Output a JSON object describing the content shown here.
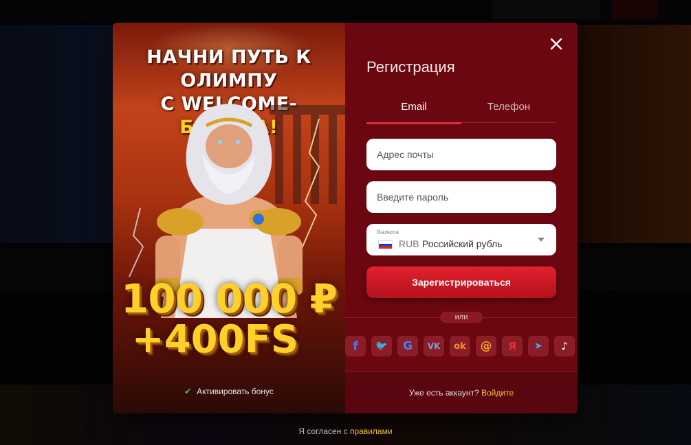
{
  "promo": {
    "title_line1": "НАЧНИ ПУТЬ К ОЛИМПУ",
    "title_line2_prefix": "С WELCOME-",
    "title_line2_highlight": "БОНУСА!",
    "amount": "100 000 ₽",
    "free_spins": "+400FS",
    "activate_label": "Активировать бонус"
  },
  "form": {
    "title": "Регистрация",
    "tabs": [
      {
        "label": "Email",
        "active": true
      },
      {
        "label": "Телефон",
        "active": false
      }
    ],
    "email_placeholder": "Адрес почты",
    "password_placeholder": "Введите пароль",
    "currency": {
      "label": "Валюта",
      "code": "RUB",
      "name": "Российский рубль",
      "flag": "russia-flag-icon"
    },
    "submit_label": "Зарегистрироваться",
    "or_label": "или",
    "socials": [
      {
        "name": "facebook-icon",
        "glyph": "f",
        "color": "#3b7cf0"
      },
      {
        "name": "twitter-icon",
        "glyph": "🐦",
        "color": "#3fa9f5"
      },
      {
        "name": "google-icon",
        "glyph": "G",
        "color": "#4285f4"
      },
      {
        "name": "vk-icon",
        "glyph": "VK",
        "color": "#6f9fd8"
      },
      {
        "name": "odnoklassniki-icon",
        "glyph": "ok",
        "color": "#f7931e"
      },
      {
        "name": "mailru-icon",
        "glyph": "@",
        "color": "#f5a623"
      },
      {
        "name": "yandex-icon",
        "glyph": "Я",
        "color": "#e8303a"
      },
      {
        "name": "telegram-icon",
        "glyph": "➤",
        "color": "#44a8e8"
      },
      {
        "name": "tiktok-icon",
        "glyph": "♪",
        "color": "#ffffff"
      }
    ],
    "login_prompt": "Уже есть аккаунт?",
    "login_link": "Войдите"
  },
  "terms": {
    "prefix": "Я согласен с",
    "link": "правилами"
  },
  "colors": {
    "form_bg": "#6a0710",
    "accent": "#e0313c",
    "link": "#f2c033"
  }
}
